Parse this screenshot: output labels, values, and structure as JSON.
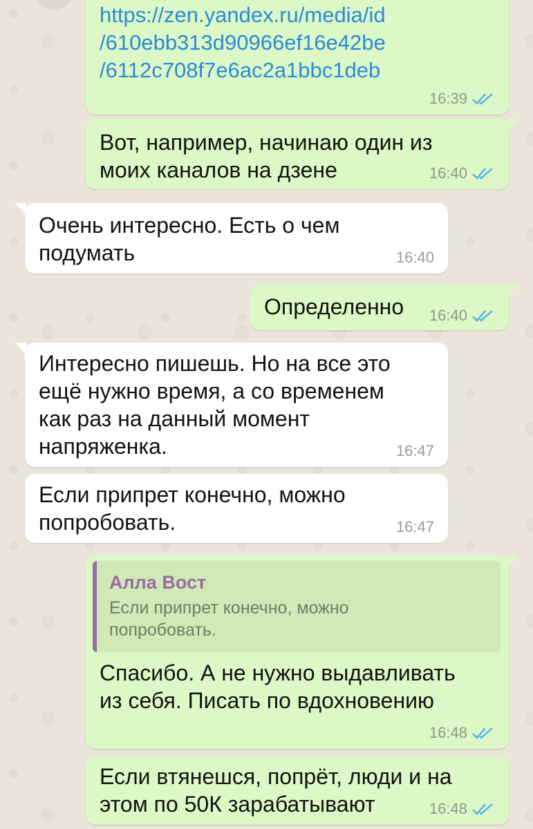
{
  "messages": [
    {
      "text": "https://zen.yandex.ru/media/id\n/610ebb313d90966ef16e42be\n/6112c708f7e6ac2a1bbc1deb",
      "time": "16:39"
    },
    {
      "text": "Вот, например, начинаю один из\nмоих каналов на дзене",
      "time": "16:40"
    },
    {
      "text": "Очень интересно. Есть о чем\nподумать",
      "time": "16:40"
    },
    {
      "text": "Определенно",
      "time": "16:40"
    },
    {
      "text": "Интересно пишешь. Но на все это\nещё нужно время, а со временем\nкак раз на данный момент\nнапряженка.",
      "time": "16:47"
    },
    {
      "text": "Если припрет конечно, можно\nпопробовать.",
      "time": "16:47"
    },
    {
      "quote": {
        "author": "Алла Вост",
        "text": "Если припрет конечно, можно\nпопробовать."
      },
      "text": "Спасибо. А не нужно выдавливать\nиз себя. Писать по вдохновению",
      "time": "16:48"
    },
    {
      "text": "Если втянешся, попрёт, люди и на\nэтом по 50К зарабатывают",
      "time": "16:48"
    }
  ],
  "colors": {
    "outgoing_bubble": "#dcf8c6",
    "incoming_bubble": "#ffffff",
    "read_ticks": "#4fb3e8",
    "link": "#2a8bd6",
    "quote_author": "#9b6aa7"
  },
  "icons": {
    "read_receipt": "double-check-icon"
  }
}
